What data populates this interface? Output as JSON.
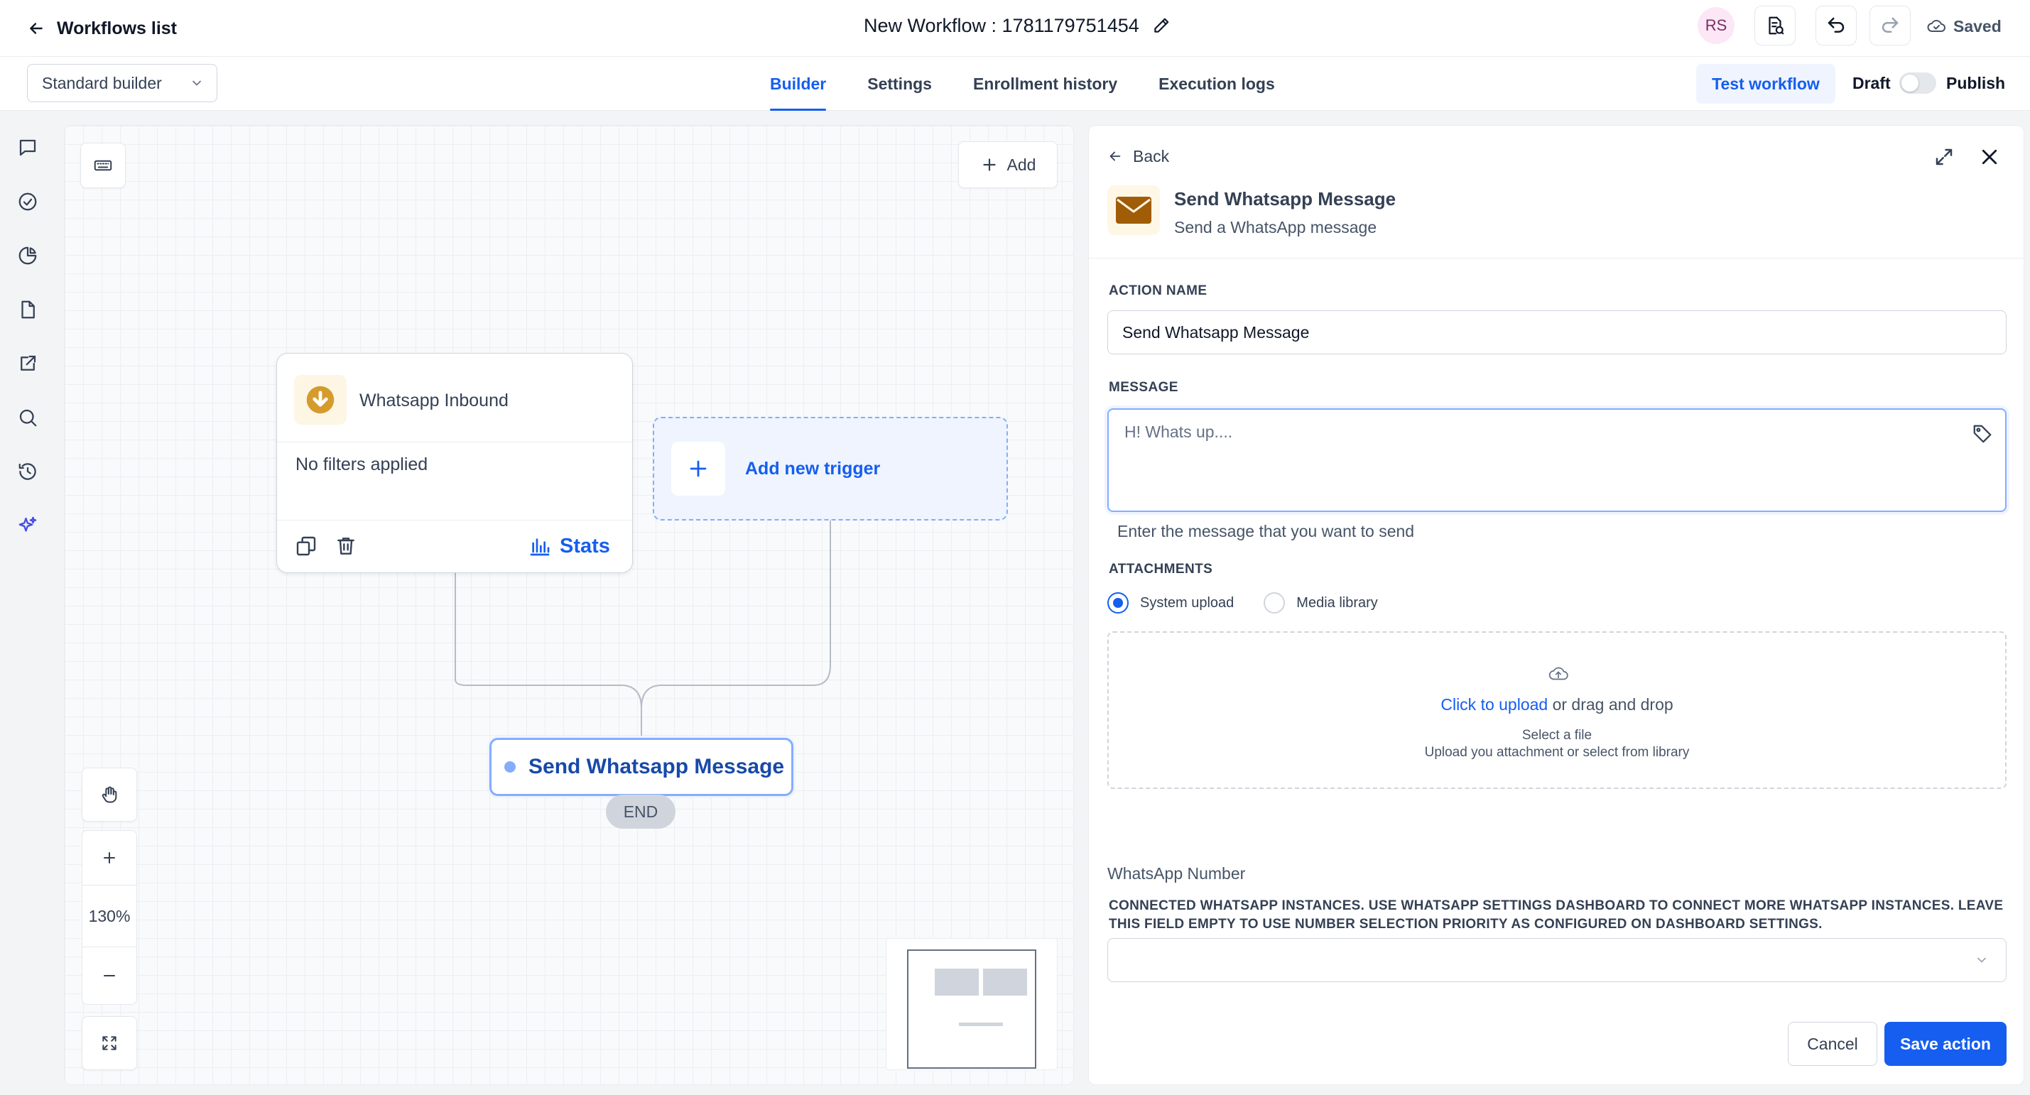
{
  "header": {
    "back_label": "Workflows list",
    "workflow_title": "New Workflow : 1781179751454",
    "avatar_initials": "RS",
    "saved_label": "Saved"
  },
  "subbar": {
    "builder_select": "Standard builder",
    "tabs": [
      {
        "label": "Builder",
        "active": true
      },
      {
        "label": "Settings",
        "active": false
      },
      {
        "label": "Enrollment history",
        "active": false
      },
      {
        "label": "Execution logs",
        "active": false
      }
    ],
    "test_workflow_label": "Test workflow",
    "draft_label": "Draft",
    "publish_label": "Publish"
  },
  "rail": {
    "icons": [
      "chat-icon",
      "check-circle-icon",
      "pie-chart-icon",
      "file-icon",
      "external-link-icon",
      "search-icon",
      "history-icon",
      "sparkles-icon"
    ]
  },
  "canvas": {
    "add_label": "Add",
    "trigger": {
      "title": "Whatsapp Inbound",
      "filters": "No filters applied",
      "stats_label": "Stats"
    },
    "new_trigger_label": "Add new trigger",
    "action_node_label": "Send Whatsapp Message",
    "end_label": "END",
    "zoom_level": "130%"
  },
  "panel": {
    "back_label": "Back",
    "title": "Send Whatsapp Message",
    "subtitle": "Send a WhatsApp message",
    "action_name_label": "ACTION NAME",
    "action_name_value": "Send Whatsapp Message",
    "message_label": "MESSAGE",
    "message_placeholder": "H! Whats up....",
    "message_hint": "Enter the message that you want to send",
    "attachments_label": "ATTACHMENTS",
    "radio_system": "System upload",
    "radio_media": "Media library",
    "upload_link": "Click to upload",
    "upload_rest": " or drag and drop",
    "upload_sub1": "Select a file",
    "upload_sub2": "Upload you attachment or select from library",
    "whatsapp_number_label": "WhatsApp Number",
    "whatsapp_number_desc": "CONNECTED WHATSAPP INSTANCES. USE WHATSAPP SETTINGS DASHBOARD TO CONNECT MORE WHATSAPP INSTANCES. LEAVE THIS FIELD EMPTY TO USE NUMBER SELECTION PRIORITY AS CONFIGURED ON DASHBOARD SETTINGS.",
    "cancel_label": "Cancel",
    "save_label": "Save action"
  },
  "colors": {
    "accent": "#155eef",
    "accent_light": "#eff4ff",
    "trigger_icon": "#d59b2c",
    "panel_icon": "#a15c07"
  }
}
